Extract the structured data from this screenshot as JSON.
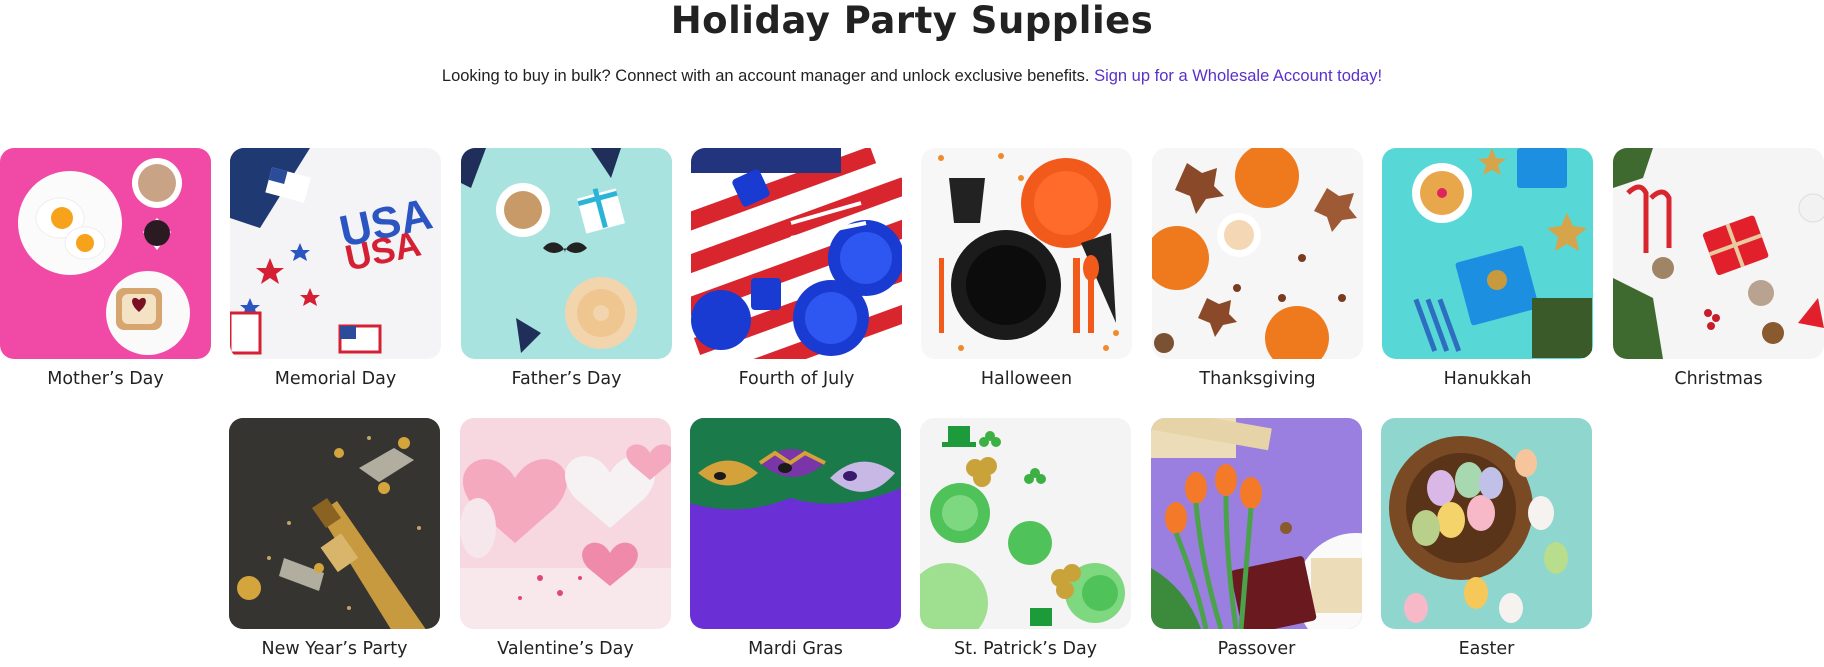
{
  "header": {
    "title": "Holiday Party Supplies",
    "subtitle_text": "Looking to buy in bulk? Connect with an account manager and unlock exclusive benefits. ",
    "subtitle_link": "Sign up for a Wholesale Account today!",
    "link_color": "#5a30c8"
  },
  "categories": {
    "row1": [
      {
        "label": "Mother’s Day",
        "bg": "#f04aa6"
      },
      {
        "label": "Memorial Day",
        "bg": "#f4f4f6"
      },
      {
        "label": "Father’s Day",
        "bg": "#a9e3df"
      },
      {
        "label": "Fourth of July",
        "bg": "#d9262e"
      },
      {
        "label": "Halloween",
        "bg": "#f7f7f7"
      },
      {
        "label": "Thanksgiving",
        "bg": "#f6f6f6"
      },
      {
        "label": "Hanukkah",
        "bg": "#57d8d6"
      },
      {
        "label": "Christmas",
        "bg": "#f5f5f5"
      }
    ],
    "row2": [
      {
        "label": "New Year’s Party",
        "bg": "#3b3a37"
      },
      {
        "label": "Valentine’s Day",
        "bg": "#f7d8e0"
      },
      {
        "label": "Mardi Gras",
        "bg": "#6b2fd6"
      },
      {
        "label": "St. Patrick’s Day",
        "bg": "#f4f4f4"
      },
      {
        "label": "Passover",
        "bg": "#9a7fe0"
      },
      {
        "label": "Easter",
        "bg": "#8fd6cf"
      }
    ]
  }
}
